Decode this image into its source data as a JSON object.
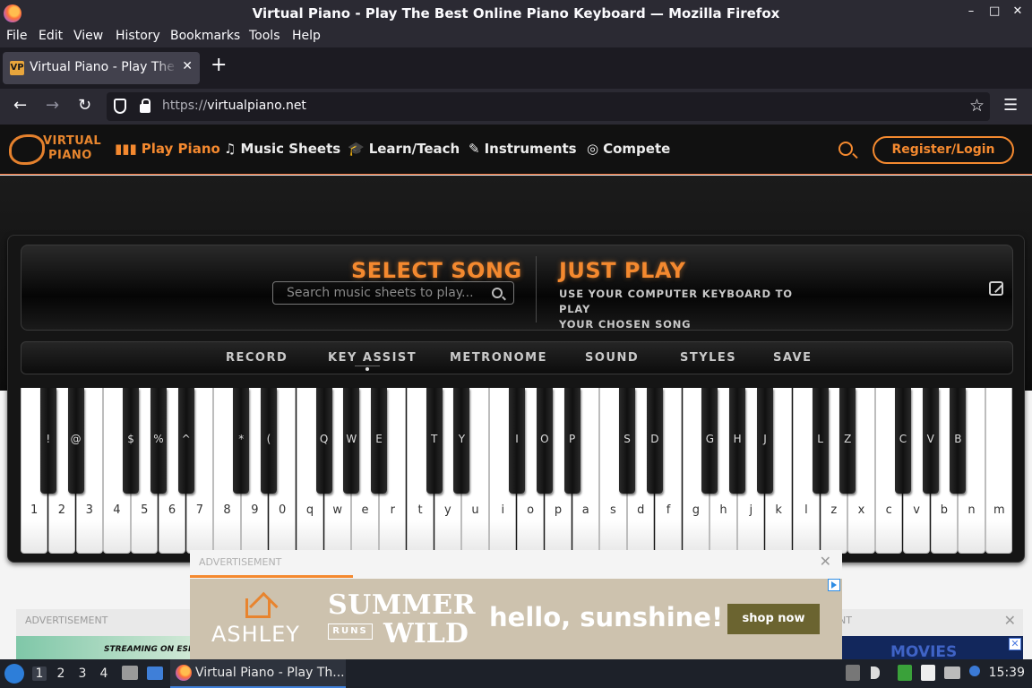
{
  "window": {
    "title": "Virtual Piano - Play The Best Online Piano Keyboard — Mozilla Firefox",
    "controls": [
      "–",
      "□",
      "✕"
    ]
  },
  "menubar": [
    "File",
    "Edit",
    "View",
    "History",
    "Bookmarks",
    "Tools",
    "Help"
  ],
  "tab": {
    "title": "Virtual Piano - Play The Best Online Piano Keyboard",
    "favicon": "VP",
    "close": "✕",
    "new_tab": "+"
  },
  "toolbar": {
    "back": "←",
    "forward": "→",
    "reload": "↻",
    "url_prefix": "https://",
    "url_host": "virtualpiano.net",
    "bookmark": "☆",
    "menu": "☰"
  },
  "site": {
    "logo": {
      "line1": "VIRTUAL",
      "line2": "PIANO"
    },
    "nav": [
      {
        "icon": "▮▮▮",
        "label": "Play Piano"
      },
      {
        "icon": "♫",
        "label": "Music Sheets"
      },
      {
        "icon": "🎓",
        "label": "Learn/Teach"
      },
      {
        "icon": "✎",
        "label": "Instruments"
      },
      {
        "icon": "◎",
        "label": "Compete"
      }
    ],
    "register_button": "Register/Login",
    "accent_color": "#f4892f"
  },
  "piano": {
    "select_song": "SELECT SONG",
    "search_placeholder": "Search music sheets to play...",
    "just_play": "JUST PLAY",
    "just_play_line1": "USE YOUR COMPUTER KEYBOARD TO PLAY",
    "just_play_line2": "YOUR CHOSEN SONG",
    "controls": [
      "RECORD",
      "KEY ASSIST",
      "METRONOME",
      "SOUND",
      "STYLES",
      "SAVE"
    ],
    "white_keys": [
      "1",
      "2",
      "3",
      "4",
      "5",
      "6",
      "7",
      "8",
      "9",
      "0",
      "q",
      "w",
      "e",
      "r",
      "t",
      "y",
      "u",
      "i",
      "o",
      "p",
      "a",
      "s",
      "d",
      "f",
      "g",
      "h",
      "j",
      "k",
      "l",
      "z",
      "x",
      "c",
      "v",
      "b",
      "n",
      "m"
    ],
    "black_keys": [
      {
        "after": 0,
        "label": "!"
      },
      {
        "after": 1,
        "label": "@"
      },
      {
        "after": 3,
        "label": "$"
      },
      {
        "after": 4,
        "label": "%"
      },
      {
        "after": 5,
        "label": "^"
      },
      {
        "after": 7,
        "label": "*"
      },
      {
        "after": 8,
        "label": "("
      },
      {
        "after": 10,
        "label": "Q"
      },
      {
        "after": 11,
        "label": "W"
      },
      {
        "after": 12,
        "label": "E"
      },
      {
        "after": 14,
        "label": "T"
      },
      {
        "after": 15,
        "label": "Y"
      },
      {
        "after": 17,
        "label": "I"
      },
      {
        "after": 18,
        "label": "O"
      },
      {
        "after": 19,
        "label": "P"
      },
      {
        "after": 21,
        "label": "S"
      },
      {
        "after": 22,
        "label": "D"
      },
      {
        "after": 24,
        "label": "G"
      },
      {
        "after": 25,
        "label": "H"
      },
      {
        "after": 26,
        "label": "J"
      },
      {
        "after": 28,
        "label": "L"
      },
      {
        "after": 29,
        "label": "Z"
      },
      {
        "after": 31,
        "label": "C"
      },
      {
        "after": 32,
        "label": "V"
      },
      {
        "after": 33,
        "label": "B"
      }
    ]
  },
  "ads": {
    "label": "ADVERTISEMENT",
    "right_label": "NT",
    "close": "✕",
    "left_text": "STREAMING ON ESPN",
    "right_text": "MOVIES",
    "brand": "ASHLEY",
    "summer": "SUMMER",
    "runs": "RUNS",
    "wild": "WILD",
    "headline": "hello, sunshine!",
    "cta": "shop now"
  },
  "taskbar": {
    "workspaces": [
      "1",
      "2",
      "3",
      "4"
    ],
    "active_workspace": "1",
    "task_title": "Virtual Piano - Play Th...",
    "clock": "15:39"
  }
}
